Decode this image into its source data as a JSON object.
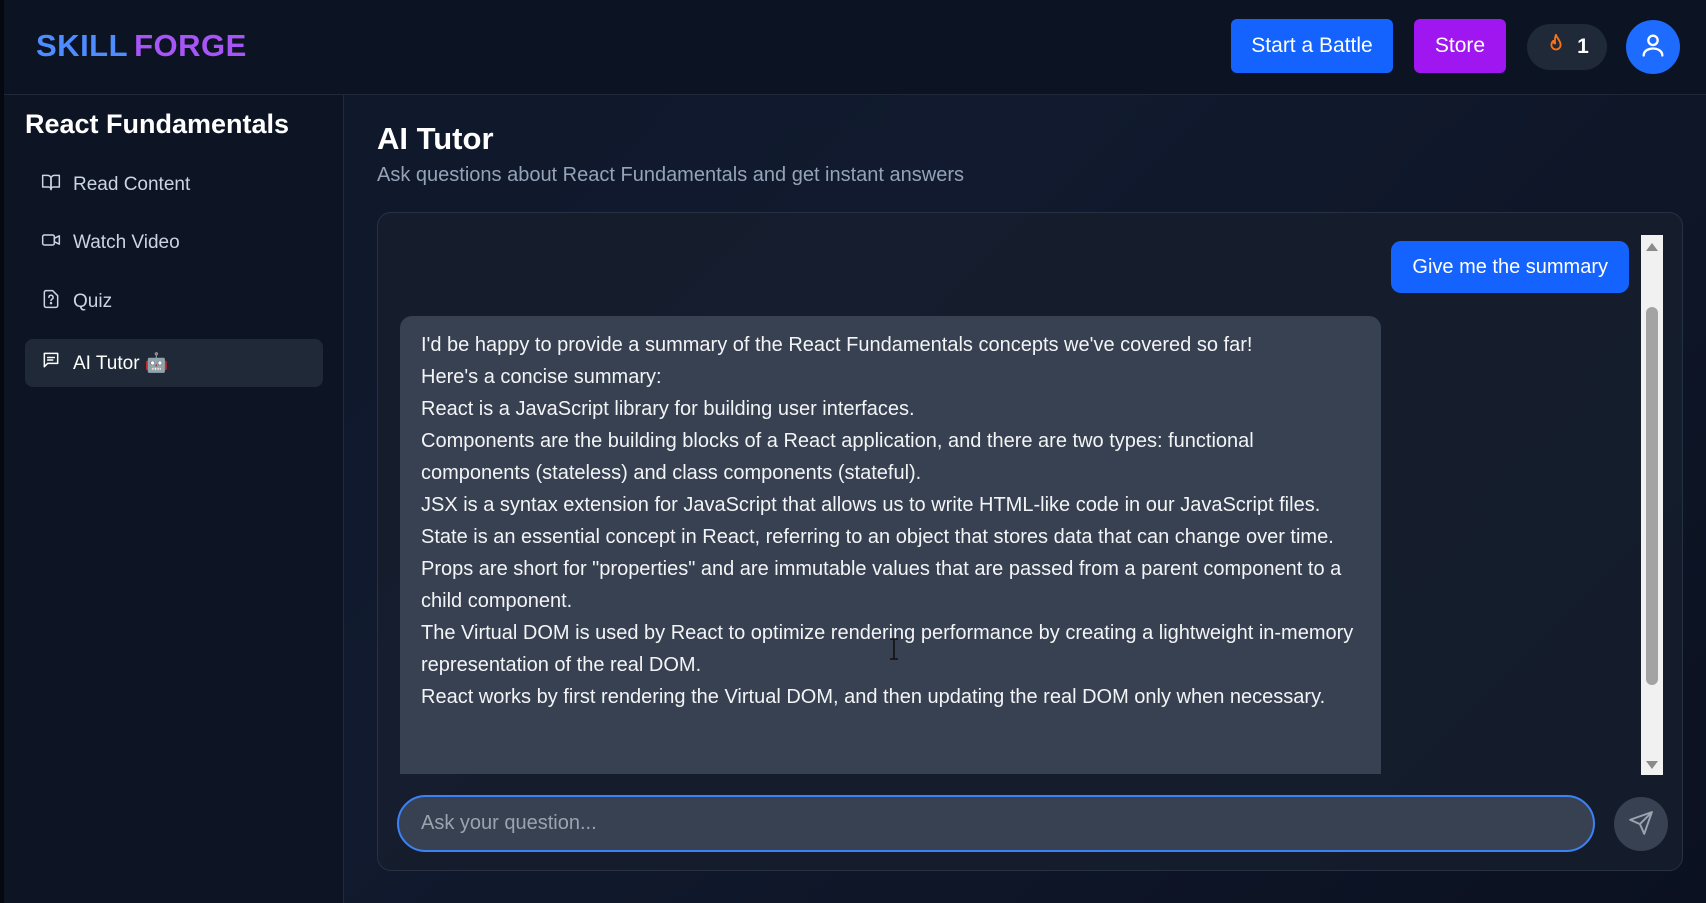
{
  "header": {
    "logo_part1": "SKILL",
    "logo_part2": "FORGE",
    "battle_label": "Start a Battle",
    "store_label": "Store",
    "streak_count": "1",
    "streak_icon": "flame-icon",
    "avatar_icon": "user-icon"
  },
  "sidebar": {
    "course_title": "React Fundamentals",
    "items": [
      {
        "label": "Read Content",
        "icon": "book-open-icon",
        "active": false
      },
      {
        "label": "Watch Video",
        "icon": "video-icon",
        "active": false
      },
      {
        "label": "Quiz",
        "icon": "quiz-icon",
        "active": false
      },
      {
        "label": "AI Tutor 🤖",
        "icon": "chat-icon",
        "active": true
      }
    ]
  },
  "main": {
    "title": "AI Tutor",
    "subtitle": "Ask questions about React Fundamentals and get instant answers"
  },
  "chat": {
    "user_message": "Give me the summary",
    "ai_lines": [
      "I'd be happy to provide a summary of the React Fundamentals concepts we've covered so far!",
      "Here's a concise summary:",
      "React is a JavaScript library for building user interfaces.",
      "Components are the building blocks of a React application, and there are two types: functional components (stateless) and class components (stateful).",
      "JSX is a syntax extension for JavaScript that allows us to write HTML-like code in our JavaScript files.",
      "State is an essential concept in React, referring to an object that stores data that can change over time.",
      "Props are short for \"properties\" and are immutable values that are passed from a parent component to a child component.",
      "The Virtual DOM is used by React to optimize rendering performance by creating a lightweight in-memory representation of the real DOM.",
      "React works by first rendering the Virtual DOM, and then updating the real DOM only when necessary."
    ],
    "input_placeholder": "Ask your question...",
    "input_value": "",
    "send_icon": "send-icon"
  },
  "colors": {
    "primary": "#1463ff",
    "store": "#a016f0",
    "logo_blue": "#4f8cff",
    "logo_purple": "#a855f7",
    "flame": "#f97316"
  }
}
